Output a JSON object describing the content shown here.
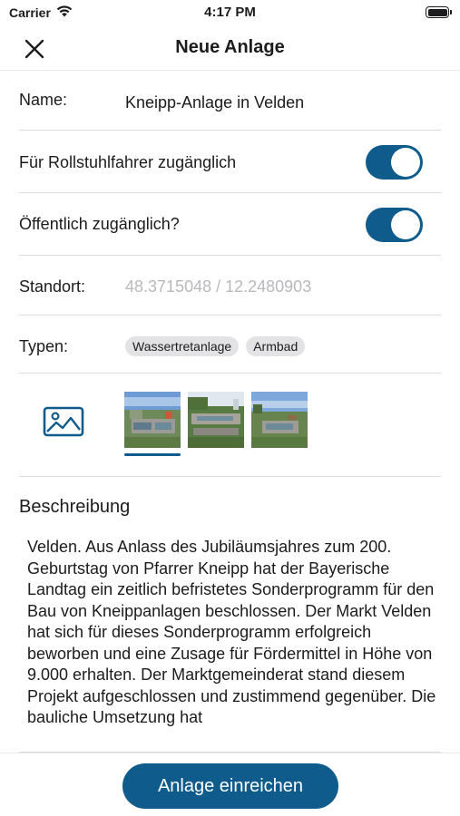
{
  "status_bar": {
    "carrier": "Carrier",
    "time": "4:17 PM"
  },
  "nav": {
    "title": "Neue Anlage",
    "close_icon": "close-icon"
  },
  "form": {
    "name_label": "Name:",
    "name_value": "Kneipp-Anlage in Velden",
    "wheelchair_label": "Für Rollstuhlfahrer zugänglich",
    "wheelchair_on": true,
    "public_label": "Öffentlich zugänglich?",
    "public_on": true,
    "location_label": "Standort:",
    "location_placeholder": "48.3715048 / 12.2480903",
    "types_label": "Typen:",
    "types": [
      "Wassertretanlage",
      "Armbad"
    ]
  },
  "images": {
    "add_icon": "image-icon",
    "selected_index": 0,
    "count": 3
  },
  "description": {
    "title": "Beschreibung",
    "text": "Velden. Aus Anlass des Jubiläumsjahres zum 200. Geburtstag von Pfarrer Kneipp hat der Bayerische Landtag ein zeitlich befristetes Sonderprogramm für den Bau von Kneippanlagen beschlossen. Der Markt Velden hat sich für dieses Sonderprogramm erfolgreich beworben und eine Zusage für Fördermittel in Höhe von 9.000 erhalten. Der Marktgemeinderat stand diesem Projekt aufgeschlossen und zustimmend gegenüber. Die bauliche Umsetzung hat"
  },
  "footer": {
    "submit_label": "Anlage einreichen"
  },
  "colors": {
    "accent": "#0f5c8c",
    "chip_bg": "#e3e3e5",
    "placeholder": "#b9b9bd"
  }
}
